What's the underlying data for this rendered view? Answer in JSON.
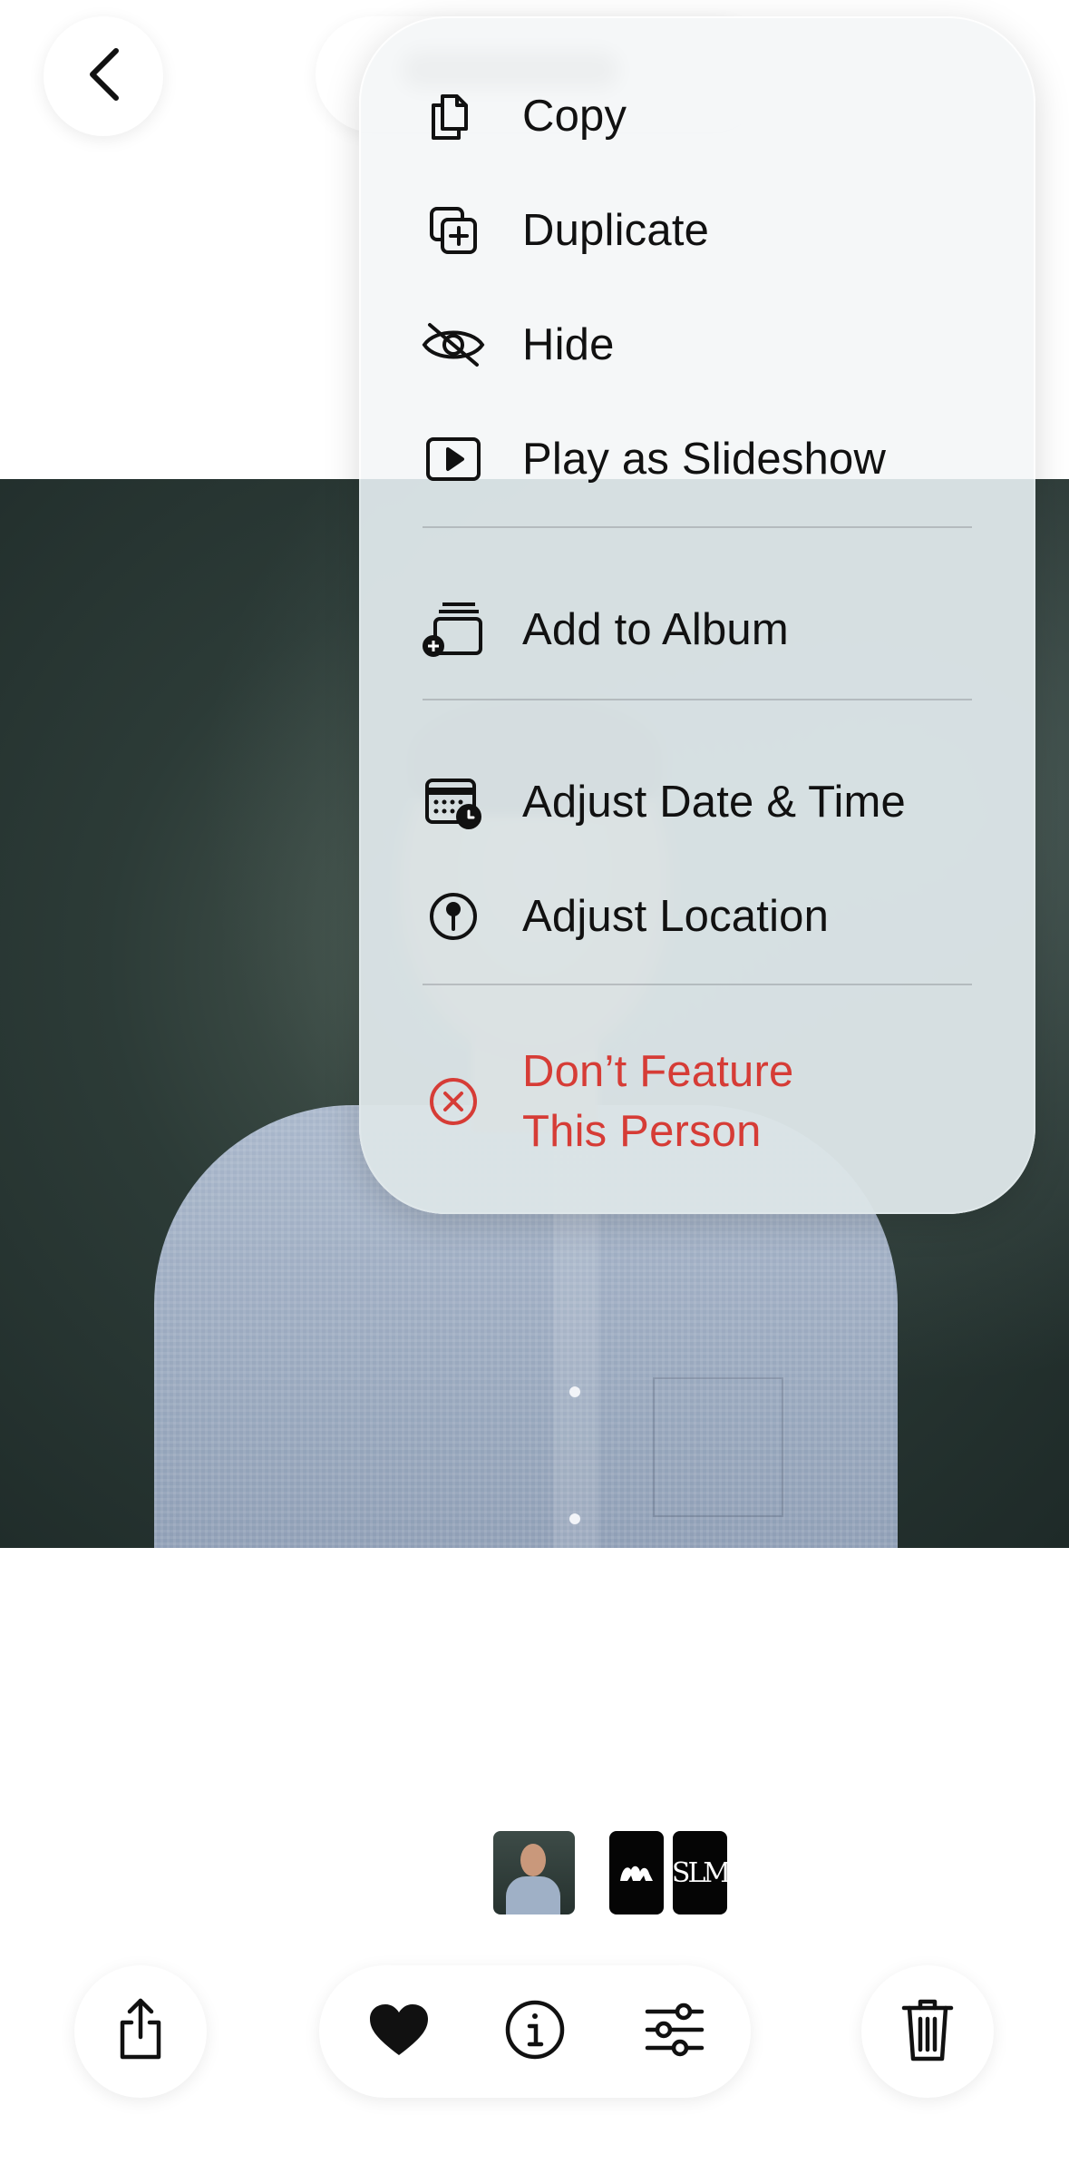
{
  "header": {
    "back_icon": "chevron-left-icon"
  },
  "menu": {
    "groups": [
      {
        "items": [
          {
            "label": "Copy",
            "icon": "copy-icon"
          },
          {
            "label": "Duplicate",
            "icon": "duplicate-icon"
          },
          {
            "label": "Hide",
            "icon": "eye-slash-icon"
          },
          {
            "label": "Play as Slideshow",
            "icon": "play-rectangle-icon"
          }
        ]
      },
      {
        "items": [
          {
            "label": "Add to Album",
            "icon": "add-to-album-icon"
          }
        ]
      },
      {
        "items": [
          {
            "label": "Adjust Date & Time",
            "icon": "calendar-clock-icon"
          },
          {
            "label": "Adjust Location",
            "icon": "location-pin-icon"
          }
        ]
      },
      {
        "items": [
          {
            "label_line1": "Don’t Feature",
            "label_line2": "This Person",
            "icon": "x-circle-icon",
            "destructive": true
          }
        ]
      }
    ]
  },
  "thumbnails": [
    {
      "kind": "photo"
    },
    {
      "kind": "logo"
    },
    {
      "kind": "logo",
      "text": "SLM"
    }
  ],
  "toolbar": {
    "share_icon": "share-icon",
    "favorite_icon": "heart-icon",
    "info_icon": "info-icon",
    "adjust_icon": "sliders-icon",
    "delete_icon": "trash-icon"
  },
  "colors": {
    "destructive": "#d63c36",
    "menu_text": "#111111"
  }
}
